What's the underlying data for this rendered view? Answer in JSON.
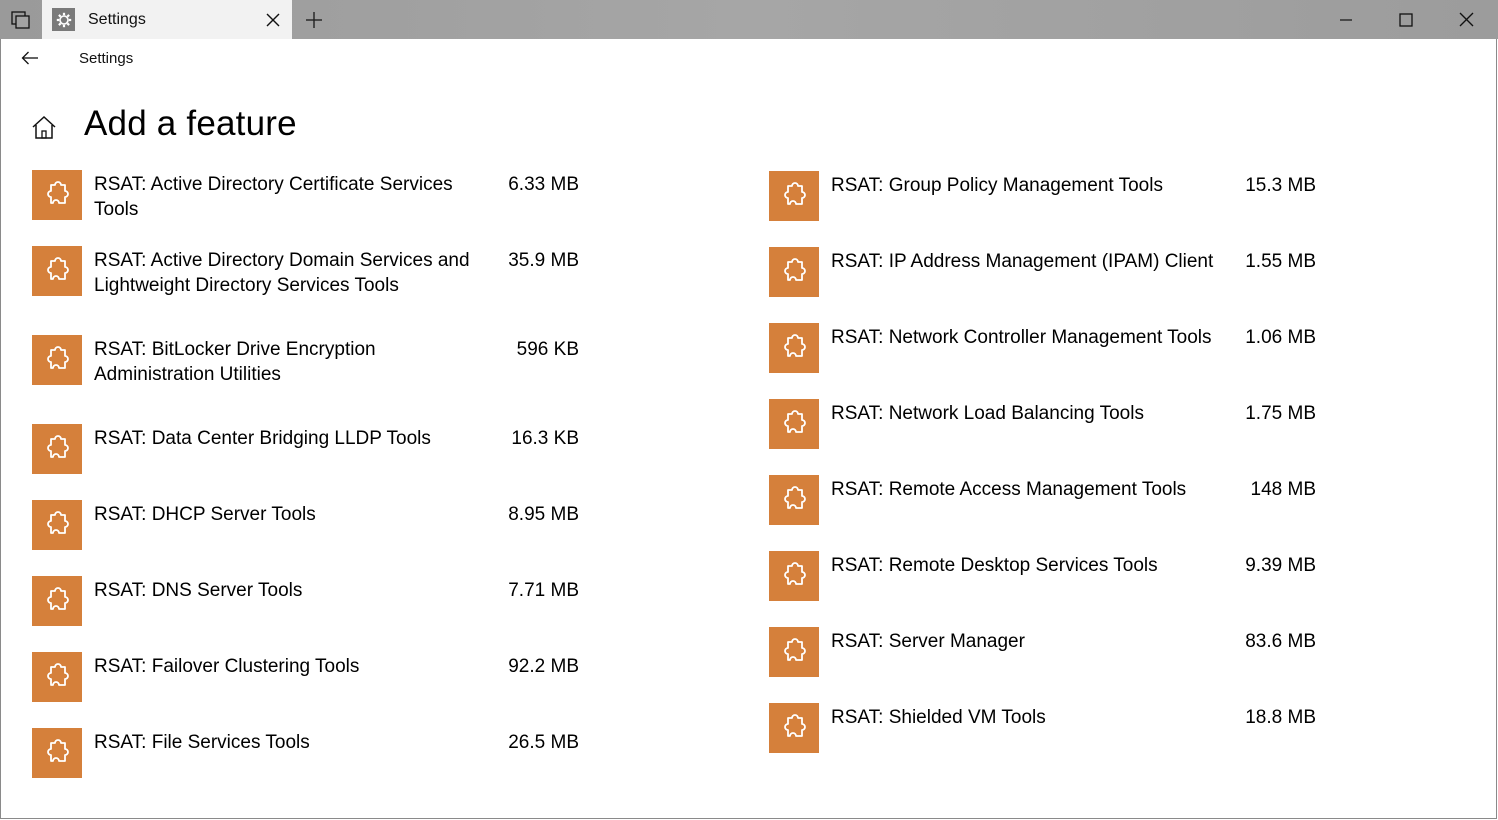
{
  "window": {
    "tab_title": "Settings"
  },
  "header": {
    "app_title": "Settings",
    "page_title": "Add a feature"
  },
  "features_left": [
    {
      "name": "RSAT: Active Directory Certificate Services Tools",
      "size": "6.33 MB"
    },
    {
      "name": "RSAT: Active Directory Domain Services and Lightweight Directory Services Tools",
      "size": "35.9 MB"
    },
    {
      "name": "RSAT: BitLocker Drive Encryption Administration Utilities",
      "size": "596 KB"
    },
    {
      "name": "RSAT: Data Center Bridging LLDP Tools",
      "size": "16.3 KB"
    },
    {
      "name": "RSAT: DHCP Server Tools",
      "size": "8.95 MB"
    },
    {
      "name": "RSAT: DNS Server Tools",
      "size": "7.71 MB"
    },
    {
      "name": "RSAT: Failover Clustering Tools",
      "size": "92.2 MB"
    },
    {
      "name": "RSAT: File Services Tools",
      "size": "26.5 MB"
    }
  ],
  "features_right": [
    {
      "name": "RSAT: Group Policy Management Tools",
      "size": "15.3 MB"
    },
    {
      "name": "RSAT: IP Address Management (IPAM) Client",
      "size": "1.55 MB"
    },
    {
      "name": "RSAT: Network Controller Management Tools",
      "size": "1.06 MB"
    },
    {
      "name": "RSAT: Network Load Balancing Tools",
      "size": "1.75 MB"
    },
    {
      "name": "RSAT: Remote Access Management Tools",
      "size": "148 MB"
    },
    {
      "name": "RSAT: Remote Desktop Services Tools",
      "size": "9.39 MB"
    },
    {
      "name": "RSAT: Server Manager",
      "size": "83.6 MB"
    },
    {
      "name": "RSAT: Shielded VM Tools",
      "size": "18.8 MB"
    }
  ],
  "icons": {
    "tabs": "tabs-icon",
    "app": "gear-icon",
    "close_tab": "close-icon",
    "new_tab": "plus-icon",
    "back": "back-arrow-icon",
    "home": "home-icon",
    "feature": "puzzle-piece-icon"
  },
  "colors": {
    "accent": "#d5803b",
    "titlebar": "#a3a3a3",
    "tab": "#f2f2f2"
  }
}
